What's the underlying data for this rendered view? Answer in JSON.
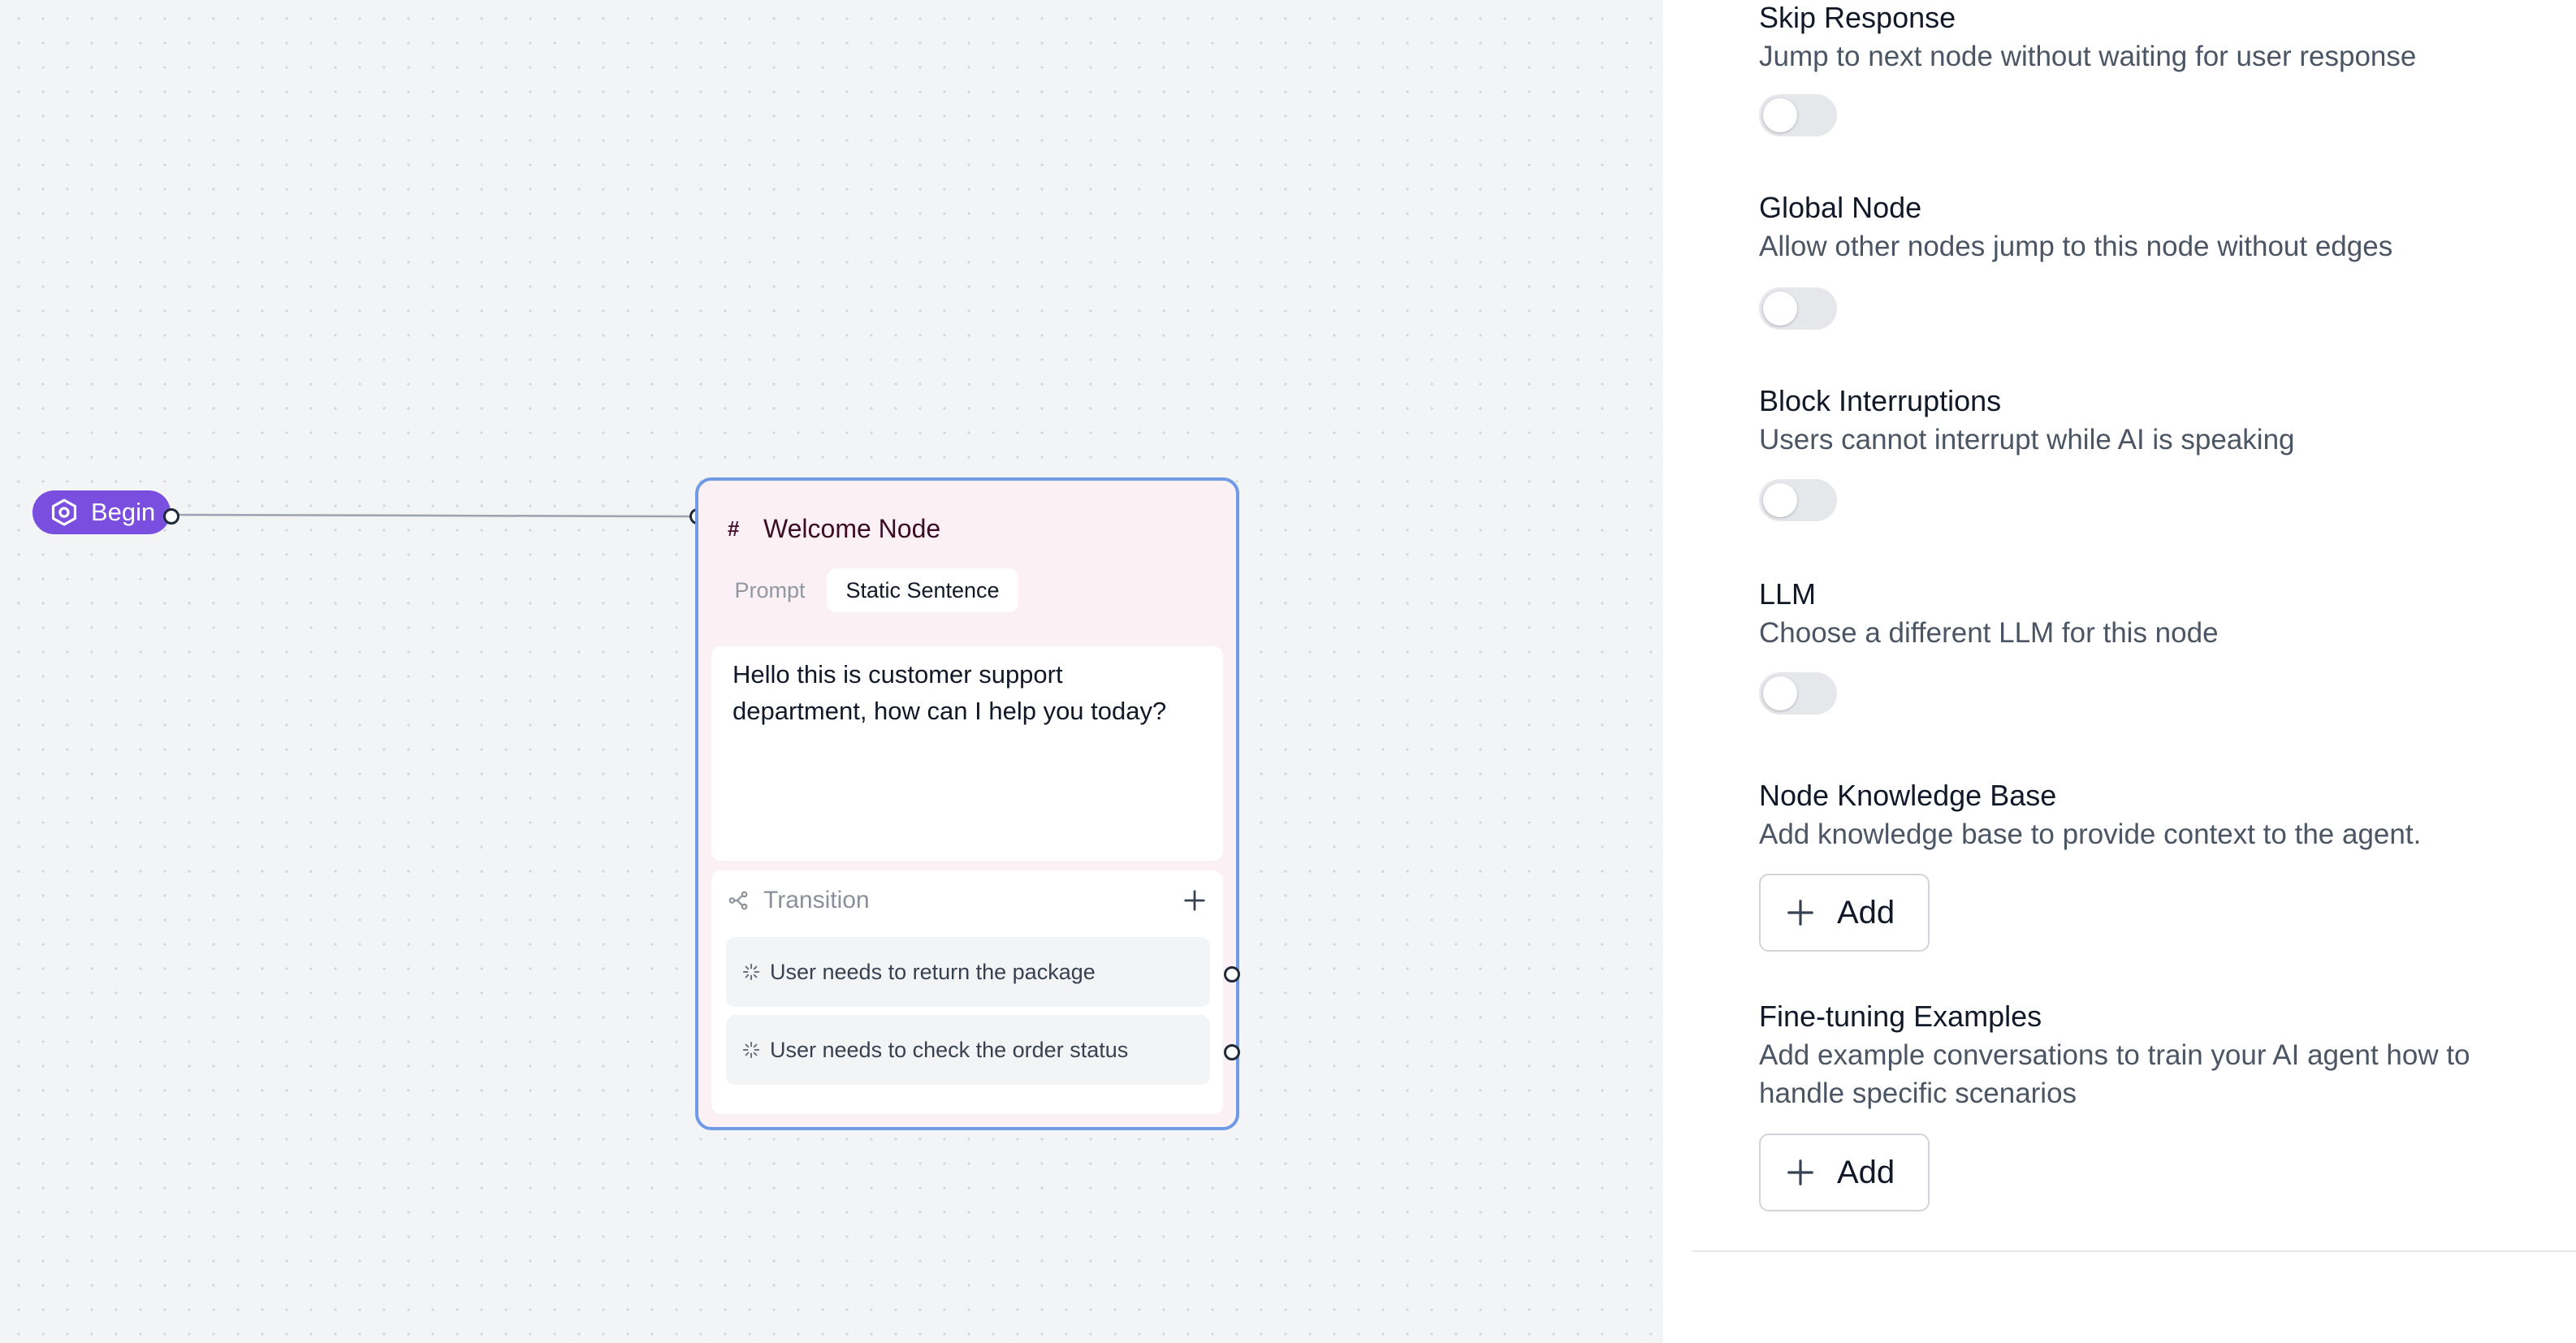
{
  "canvas": {
    "begin": {
      "label": "Begin",
      "icon": "hexagon-gear-icon"
    },
    "node": {
      "title": "Welcome Node",
      "title_icon": "hash-icon",
      "tabs": [
        {
          "label": "Prompt",
          "active": false
        },
        {
          "label": "Static Sentence",
          "active": true
        }
      ],
      "static_sentence": "Hello this is customer support department, how can I help you today?",
      "transition": {
        "label": "Transition",
        "icon": "branch-icon",
        "add_icon": "plus-icon",
        "conditions": [
          {
            "label": "User needs to return the package",
            "icon": "sparkle-icon"
          },
          {
            "label": "User needs to check the order status",
            "icon": "sparkle-icon"
          }
        ]
      }
    }
  },
  "settings": {
    "skip_response": {
      "title": "Skip Response",
      "description": "Jump to next node without waiting for user response",
      "enabled": false
    },
    "global_node": {
      "title": "Global Node",
      "description": "Allow other nodes jump to this node without edges",
      "enabled": false
    },
    "block_interruptions": {
      "title": "Block Interruptions",
      "description": "Users cannot interrupt while AI is speaking",
      "enabled": false
    },
    "llm": {
      "title": "LLM",
      "description": "Choose a different LLM for this node",
      "enabled": false
    },
    "knowledge_base": {
      "title": "Node Knowledge Base",
      "description": "Add knowledge base to provide context to the agent.",
      "add_label": "Add"
    },
    "fine_tuning": {
      "title": "Fine-tuning Examples",
      "description": "Add example conversations to train your AI agent how to handle specific scenarios",
      "add_label": "Add"
    }
  },
  "colors": {
    "begin": "#7a4fe0",
    "node_border": "#6f9ae6",
    "node_bg": "#fbf1f5",
    "canvas_bg": "#f3f4f6",
    "toggle_off": "#e5e7eb"
  }
}
